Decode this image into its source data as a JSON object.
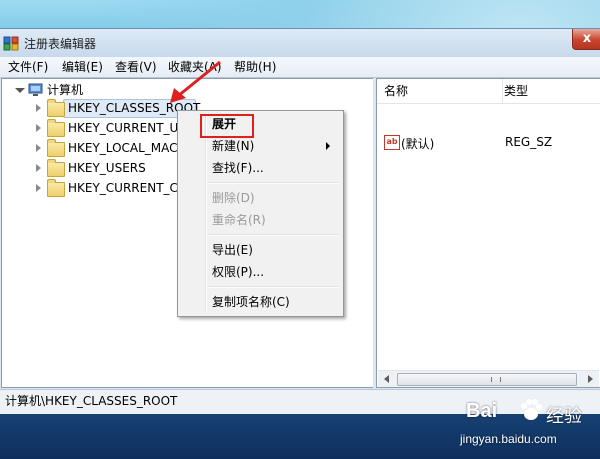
{
  "window": {
    "title": "注册表编辑器",
    "close_glyph": "x"
  },
  "menubar": {
    "items": [
      "文件(F)",
      "编辑(E)",
      "查看(V)",
      "收藏夹(A)",
      "帮助(H)"
    ]
  },
  "tree": {
    "root": "计算机",
    "keys": [
      "HKEY_CLASSES_ROOT",
      "HKEY_CURRENT_USER",
      "HKEY_LOCAL_MACHINE",
      "HKEY_USERS",
      "HKEY_CURRENT_CONFIG"
    ],
    "selected": "HKEY_CLASSES_ROOT"
  },
  "list": {
    "columns": [
      "名称",
      "类型"
    ],
    "rows": [
      {
        "name": "(默认)",
        "type": "REG_SZ",
        "icon": "ab"
      }
    ]
  },
  "context_menu": {
    "items": [
      {
        "label": "展开",
        "bold": true,
        "highlighted": true
      },
      {
        "label": "新建(N)",
        "submenu": true
      },
      {
        "label": "查找(F)..."
      },
      {
        "label": "删除(D)",
        "disabled": true
      },
      {
        "label": "重命名(R)",
        "disabled": true
      },
      {
        "label": "导出(E)"
      },
      {
        "label": "权限(P)..."
      },
      {
        "label": "复制项名称(C)"
      }
    ]
  },
  "statusbar": {
    "path": "计算机\\HKEY_CLASSES_ROOT"
  },
  "watermark": {
    "brand": "Bai",
    "brand_suffix": "经验",
    "url": "jingyan.baidu.com"
  },
  "colors": {
    "annotation_red": "#e0201c",
    "folder": "#eecf6a",
    "title_bar": "#c7d9ec"
  }
}
